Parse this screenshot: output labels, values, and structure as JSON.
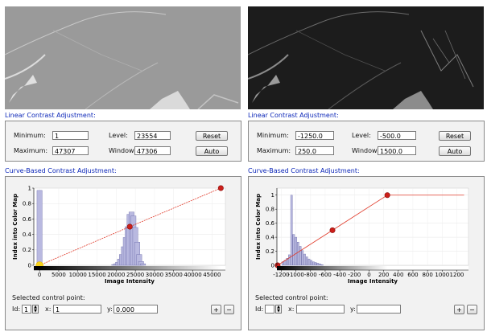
{
  "left": {
    "linear_title": "Linear Contrast Adjustment:",
    "curve_title": "Curve-Based Contrast Adjustment:",
    "minimum_label": "Minimum:",
    "minimum_value": "1",
    "maximum_label": "Maximum:",
    "maximum_value": "47307",
    "level_label": "Level:",
    "level_value": "23554",
    "window_label": "Window:",
    "window_value": "47306",
    "reset_label": "Reset",
    "auto_label": "Auto",
    "selected_label": "Selected control point:",
    "id_label": "Id:",
    "id_value": "1",
    "x_label": "x:",
    "x_value": "1",
    "y_label": "y:",
    "y_value": "0.000",
    "plus_label": "+",
    "minus_label": "−"
  },
  "right": {
    "linear_title": "Linear Contrast Adjustment:",
    "curve_title": "Curve-Based Contrast Adjustment:",
    "minimum_label": "Minimum:",
    "minimum_value": "-1250.0",
    "maximum_label": "Maximum:",
    "maximum_value": "250.0",
    "level_label": "Level:",
    "level_value": "-500.0",
    "window_label": "Window:",
    "window_value": "1500.0",
    "reset_label": "Reset",
    "auto_label": "Auto",
    "selected_label": "Selected control point:",
    "id_label": "Id:",
    "id_value": "",
    "x_label": "x:",
    "x_value": "",
    "y_label": "y:",
    "y_value": "",
    "plus_label": "+",
    "minus_label": "−"
  },
  "chart_data": [
    {
      "type": "line",
      "panel": "left",
      "xlabel": "Image Intensity",
      "ylabel": "Index into Color Map",
      "xlim": [
        -1500,
        48500
      ],
      "ylim": [
        0,
        1
      ],
      "xticks": [
        0,
        5000,
        10000,
        15000,
        20000,
        25000,
        30000,
        35000,
        40000,
        45000
      ],
      "yticks": [
        0,
        0.2,
        0.4,
        0.6,
        0.8,
        1
      ],
      "control_points": [
        {
          "x": 1,
          "y": 0,
          "selected": true
        },
        {
          "x": 23554,
          "y": 0.5,
          "selected": false
        },
        {
          "x": 47307,
          "y": 1,
          "selected": false
        }
      ],
      "histogram": {
        "x": [
          0,
          19500,
          20000,
          20500,
          21000,
          21500,
          22000,
          22500,
          23000,
          23500,
          24000,
          24500,
          25000,
          25500,
          26000,
          26500,
          27000
        ],
        "y": [
          0.97,
          0.01,
          0.02,
          0.04,
          0.08,
          0.14,
          0.24,
          0.36,
          0.5,
          0.66,
          0.69,
          0.64,
          0.49,
          0.3,
          0.14,
          0.05,
          0.02
        ]
      }
    },
    {
      "type": "line",
      "panel": "right",
      "xlabel": "Image Intensity",
      "ylabel": "Index into Color Map",
      "xlim": [
        -1260,
        1360
      ],
      "ylim": [
        0,
        1.1
      ],
      "xticks": [
        -1200,
        -1000,
        -800,
        -600,
        -400,
        -200,
        0,
        200,
        400,
        600,
        800,
        1000,
        1200
      ],
      "yticks": [
        0,
        0.2,
        0.4,
        0.6,
        0.8,
        1
      ],
      "control_points": [
        {
          "x": -1250,
          "y": 0,
          "selected": false
        },
        {
          "x": -500,
          "y": 0.5,
          "selected": false
        },
        {
          "x": 250,
          "y": 1,
          "selected": false
        }
      ],
      "flat_until": 1300,
      "histogram": {
        "x": [
          -1180,
          -1150,
          -1120,
          -1090,
          -1060,
          -1030,
          -1000,
          -970,
          -940,
          -910,
          -880,
          -850,
          -820,
          -790,
          -760,
          -730,
          -700,
          -670,
          -640
        ],
        "y": [
          0.05,
          0.07,
          0.1,
          0.15,
          1.0,
          0.44,
          0.4,
          0.33,
          0.27,
          0.21,
          0.16,
          0.12,
          0.09,
          0.07,
          0.05,
          0.04,
          0.03,
          0.02,
          0.01
        ]
      }
    }
  ]
}
